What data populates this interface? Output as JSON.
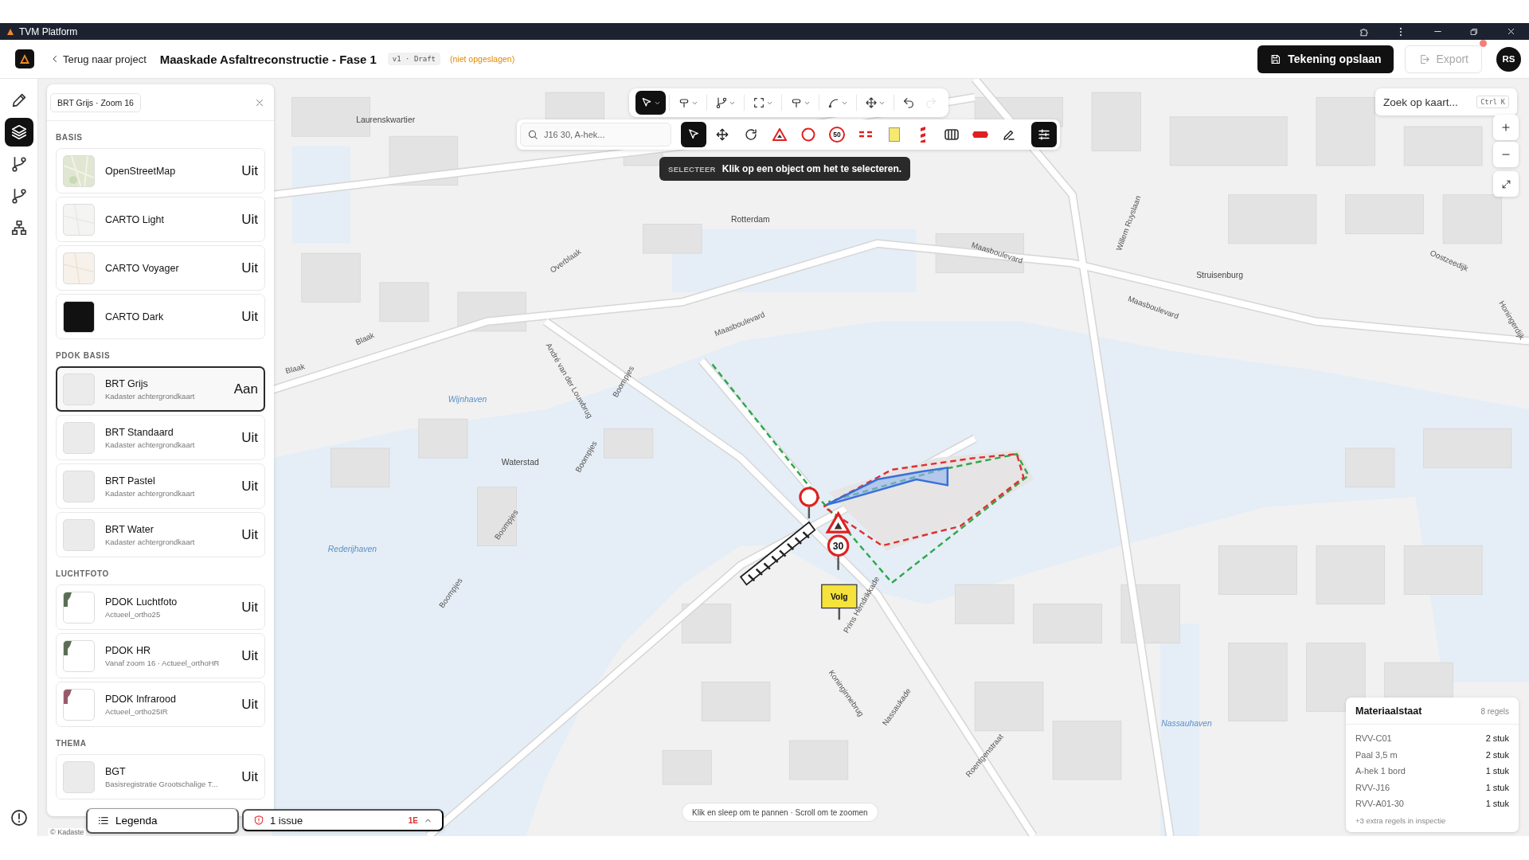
{
  "title_bar": {
    "title": "TVM Platform"
  },
  "header": {
    "back_link": "Terug naar project",
    "project_title": "Maaskade Asfaltreconstructie - Fase 1",
    "version_badge": "v1 · Draft",
    "save_status": "(niet opgeslagen)",
    "save_button": "Tekening opslaan",
    "export_button": {
      "label": "Export",
      "disabled": true
    },
    "notification": true,
    "avatar": "RS"
  },
  "sidebar": {
    "items": [
      {
        "kind": "pencil",
        "selected": false
      },
      {
        "kind": "layers",
        "selected": true
      },
      {
        "kind": "branch",
        "selected": false
      },
      {
        "kind": "branch",
        "selected": false
      },
      {
        "kind": "hierarchy",
        "selected": false
      }
    ]
  },
  "layer_panel": {
    "chip": "BRT Grijs · Zoom 16",
    "sections": [
      {
        "title": "BASIS",
        "layers": [
          {
            "name": "OpenStreetMap",
            "status": "Uit",
            "selected": false,
            "kind": "osm"
          },
          {
            "name": "CARTO Light",
            "status": "Uit",
            "selected": false,
            "kind": "light"
          },
          {
            "name": "CARTO Voyager",
            "status": "Uit",
            "selected": false,
            "kind": "voyager"
          },
          {
            "name": "CARTO Dark",
            "status": "Uit",
            "selected": false,
            "kind": "dark"
          }
        ]
      },
      {
        "title": "PDOK BASIS",
        "layers": [
          {
            "name": "BRT Grijs",
            "description": "Kadaster achtergrondkaart",
            "status": "Aan",
            "selected": true,
            "kind": "blank"
          },
          {
            "name": "BRT Standaard",
            "description": "Kadaster achtergrondkaart",
            "status": "Uit",
            "selected": false,
            "kind": "blank"
          },
          {
            "name": "BRT Pastel",
            "description": "Kadaster achtergrondkaart",
            "status": "Uit",
            "selected": false,
            "kind": "blank"
          },
          {
            "name": "BRT Water",
            "description": "Kadaster achtergrondkaart",
            "status": "Uit",
            "selected": false,
            "kind": "blank"
          }
        ]
      },
      {
        "title": "LUCHTFOTO",
        "layers": [
          {
            "name": "PDOK Luchtfoto",
            "description": "Actueel_ortho25",
            "status": "Uit",
            "selected": false,
            "kind": "photo",
            "color": "#5a6e55"
          },
          {
            "name": "PDOK HR",
            "description": "Vanaf zoom 16 · Actueel_orthoHR",
            "status": "Uit",
            "selected": false,
            "kind": "photo",
            "color": "#5a6e55"
          },
          {
            "name": "PDOK Infrarood",
            "description": "Actueel_ortho25IR",
            "status": "Uit",
            "selected": false,
            "kind": "photo",
            "color": "#9a5a6a"
          }
        ]
      },
      {
        "title": "THEMA",
        "layers": [
          {
            "name": "BGT",
            "description": "Basisregistratie Grootschalige T...",
            "status": "Uit",
            "selected": false,
            "kind": "blank"
          }
        ]
      }
    ]
  },
  "legend_button": "Legenda",
  "attribution": "© Kadaste",
  "issues": {
    "label": "1 issue",
    "code": "1E"
  },
  "map_hint": "Klik en sleep om te pannen · Scroll om te zoomen",
  "map_search": {
    "placeholder": "Zoek op kaart...",
    "shortcut": "Ctrl K"
  },
  "toolbar": {
    "items": [
      {
        "kind": "select",
        "selected": true,
        "disabled": false,
        "dropdown": true
      },
      {
        "kind": "sign",
        "selected": false,
        "disabled": false,
        "dropdown": true
      },
      {
        "kind": "branch",
        "selected": false,
        "disabled": false,
        "dropdown": true
      },
      {
        "kind": "area",
        "selected": false,
        "disabled": false,
        "dropdown": true
      },
      {
        "kind": "sign",
        "selected": false,
        "disabled": false,
        "dropdown": true
      },
      {
        "kind": "curve",
        "selected": false,
        "disabled": false,
        "dropdown": true
      },
      {
        "kind": "move",
        "selected": false,
        "disabled": false,
        "dropdown": true
      },
      {
        "kind": "undo",
        "selected": false,
        "disabled": false,
        "dropdown": false
      },
      {
        "kind": "redo",
        "selected": false,
        "disabled": true,
        "dropdown": false
      }
    ]
  },
  "tool_palette": {
    "search_placeholder": "J16 30, A-hek...",
    "tools": [
      {
        "kind": "pointer",
        "selected": true
      },
      {
        "kind": "move",
        "selected": false
      },
      {
        "kind": "rotate",
        "selected": false
      },
      {
        "kind": "warning",
        "selected": false
      },
      {
        "kind": "prohibition",
        "selected": false
      },
      {
        "kind": "speed",
        "label": "50",
        "selected": false
      },
      {
        "kind": "lights",
        "selected": false
      },
      {
        "kind": "board",
        "selected": false
      },
      {
        "kind": "pole",
        "selected": false
      },
      {
        "kind": "fence",
        "selected": false
      },
      {
        "kind": "barrier",
        "selected": false
      },
      {
        "kind": "pen",
        "selected": false
      },
      {
        "kind": "settings",
        "selected": true
      }
    ]
  },
  "tooltip": {
    "mode": "SELECTEER",
    "text": "Klik op een object om het te selecteren."
  },
  "materials": {
    "title": "Materiaalstaat",
    "count": "8 regels",
    "rows": [
      {
        "item": "RVV-C01",
        "quantity": "2 stuk"
      },
      {
        "item": "Paal 3,5 m",
        "quantity": "2 stuk"
      },
      {
        "item": "A-hek 1 bord",
        "quantity": "1 stuk"
      },
      {
        "item": "RVV-J16",
        "quantity": "1 stuk"
      },
      {
        "item": "RVV-A01-30",
        "quantity": "1 stuk"
      }
    ],
    "footer": "+3 extra regels in inspectie"
  },
  "map": {
    "speed_sign": "30",
    "detour_sign": "Volg",
    "labels": [
      {
        "text": "Laurenskwartier",
        "kind": "place"
      },
      {
        "text": "Rotterdam",
        "kind": "place"
      },
      {
        "text": "Overblaak",
        "kind": "street"
      },
      {
        "text": "Maasboulevard",
        "kind": "street"
      },
      {
        "text": "Maasboulevard",
        "kind": "street"
      },
      {
        "text": "Maasboulevard",
        "kind": "street"
      },
      {
        "text": "Struisenburg",
        "kind": "place"
      },
      {
        "text": "Oostzeedijk",
        "kind": "street"
      },
      {
        "text": "Willem Ruyslaan",
        "kind": "street"
      },
      {
        "text": "Blaak",
        "kind": "street"
      },
      {
        "text": "Blaak",
        "kind": "street"
      },
      {
        "text": "André van der Louwbrug",
        "kind": "street"
      },
      {
        "text": "Boompjes",
        "kind": "street"
      },
      {
        "text": "Wijnhaven",
        "kind": "water"
      },
      {
        "text": "Waterstad",
        "kind": "place"
      },
      {
        "text": "Boompjes",
        "kind": "street"
      },
      {
        "text": "Boompjes",
        "kind": "street"
      },
      {
        "text": "Rederijhaven",
        "kind": "water"
      },
      {
        "text": "Boompjes",
        "kind": "street"
      },
      {
        "text": "Prins Hendrikkade",
        "kind": "street"
      },
      {
        "text": "Koninginnebrug",
        "kind": "street"
      },
      {
        "text": "Nassaukade",
        "kind": "street"
      },
      {
        "text": "Roentgenstraat",
        "kind": "street"
      },
      {
        "text": "Nassauhaven",
        "kind": "water"
      },
      {
        "text": "Honingerdijk",
        "kind": "street"
      }
    ]
  }
}
